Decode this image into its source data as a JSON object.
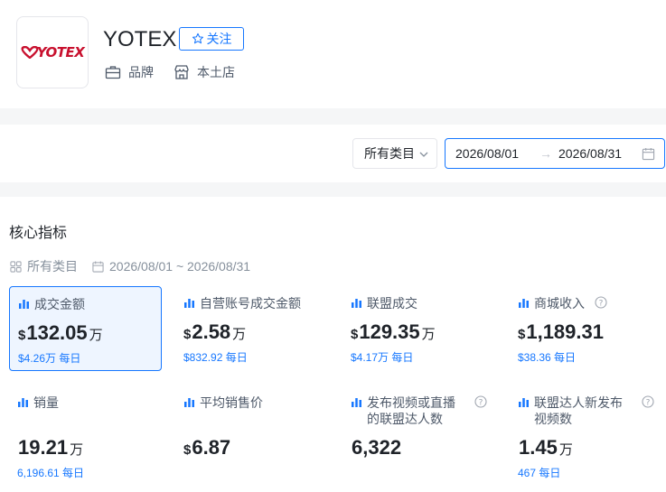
{
  "brand": {
    "logo_text": "YOTEX",
    "name": "YOTEX",
    "follow_label": "关注",
    "tags": [
      "品牌",
      "本土店"
    ]
  },
  "filters": {
    "category": "所有类目",
    "date_start": "2026/08/01",
    "date_arrow": "→",
    "date_end": "2026/08/31"
  },
  "core": {
    "title": "核心指标",
    "meta_category": "所有类目",
    "meta_range": "2026/08/01 ~ 2026/08/31"
  },
  "metrics": [
    {
      "label": "成交金额",
      "currency": "$",
      "value": "132.05",
      "unit": "万",
      "sub": "$4.26万 每日",
      "active": true
    },
    {
      "label": "自营账号成交金额",
      "currency": "$",
      "value": "2.58",
      "unit": "万",
      "sub": "$832.92 每日"
    },
    {
      "label": "联盟成交",
      "currency": "$",
      "value": "129.35",
      "unit": "万",
      "sub": "$4.17万 每日"
    },
    {
      "label": "商城收入",
      "currency": "$",
      "value": "1,189.31",
      "unit": "",
      "sub": "$38.36 每日",
      "help": true
    },
    {
      "label": "销量",
      "currency": "",
      "value": "19.21",
      "unit": "万",
      "sub": "6,196.61 每日"
    },
    {
      "label": "平均销售价",
      "currency": "$",
      "value": "6.87",
      "unit": "",
      "sub": ""
    },
    {
      "label": "发布视频或直播的联盟达人数",
      "currency": "",
      "value": "6,322",
      "unit": "",
      "sub": "",
      "help": true
    },
    {
      "label": "联盟达人新发布视频数",
      "currency": "",
      "value": "1.45",
      "unit": "万",
      "sub": "467 每日",
      "help": true
    }
  ],
  "colors": {
    "accent": "#1677ff",
    "logo": "#c8102e",
    "band": "#f5f6f7"
  }
}
